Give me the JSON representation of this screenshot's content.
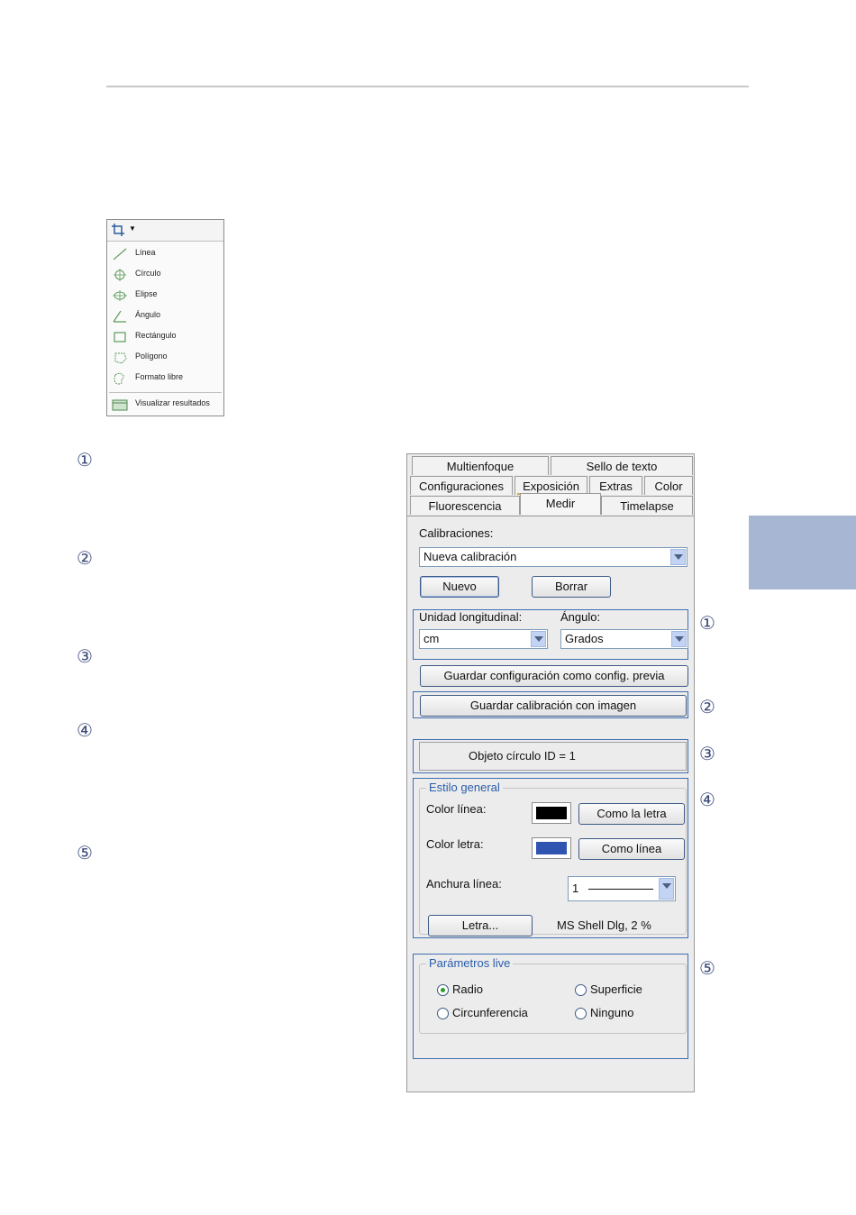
{
  "menu": {
    "items": [
      {
        "label": "Línea",
        "icon": "line-icon"
      },
      {
        "label": "Círculo",
        "icon": "circle-icon"
      },
      {
        "label": "Elipse",
        "icon": "ellipse-icon"
      },
      {
        "label": "Ángulo",
        "icon": "angle-icon"
      },
      {
        "label": "Rectángulo",
        "icon": "rectangle-icon"
      },
      {
        "label": "Polígono",
        "icon": "polygon-icon"
      },
      {
        "label": "Formato libre",
        "icon": "freeform-icon"
      }
    ],
    "results_label": "Visualizar resultados"
  },
  "callouts": {
    "left": [
      "①",
      "②",
      "③",
      "④",
      "⑤"
    ],
    "right": [
      "①",
      "②",
      "③",
      "④",
      "⑤"
    ]
  },
  "tabs": {
    "row1": [
      "Multienfoque",
      "Sello de texto"
    ],
    "row2": [
      "Configuraciones",
      "Exposición",
      "Extras",
      "Color"
    ],
    "row3": [
      "Fluorescencia",
      "Medir",
      "Timelapse"
    ],
    "active": "Medir"
  },
  "calibration": {
    "label": "Calibraciones:",
    "selected": "Nueva calibración",
    "new_button": "Nuevo",
    "delete_button": "Borrar"
  },
  "units": {
    "length_label": "Unidad longitudinal:",
    "length_value": "cm",
    "angle_label": "Ángulo:",
    "angle_value": "Grados"
  },
  "buttons": {
    "save_config": "Guardar configuración como config. previa",
    "save_calibration": "Guardar calibración con imagen"
  },
  "object_info": "Objeto círculo ID =  1",
  "style": {
    "title": "Estilo general",
    "line_color_label": "Color línea:",
    "line_color": "#000000",
    "like_text_button": "Como la letra",
    "text_color_label": "Color letra:",
    "text_color": "#2f55b0",
    "like_line_button": "Como línea",
    "line_width_label": "Anchura línea:",
    "line_width_value": "1",
    "font_button": "Letra...",
    "font_value": "MS Shell Dlg, 2 %"
  },
  "live": {
    "title": "Parámetros live",
    "options": [
      "Radio",
      "Superficie",
      "Circunferencia",
      "Ninguno"
    ],
    "selected": "Radio"
  },
  "colors": {
    "accent_tab": "#a7b6d2",
    "highlight_box": "#3f6fb0",
    "active_tab_marker": "#e8a33a"
  }
}
